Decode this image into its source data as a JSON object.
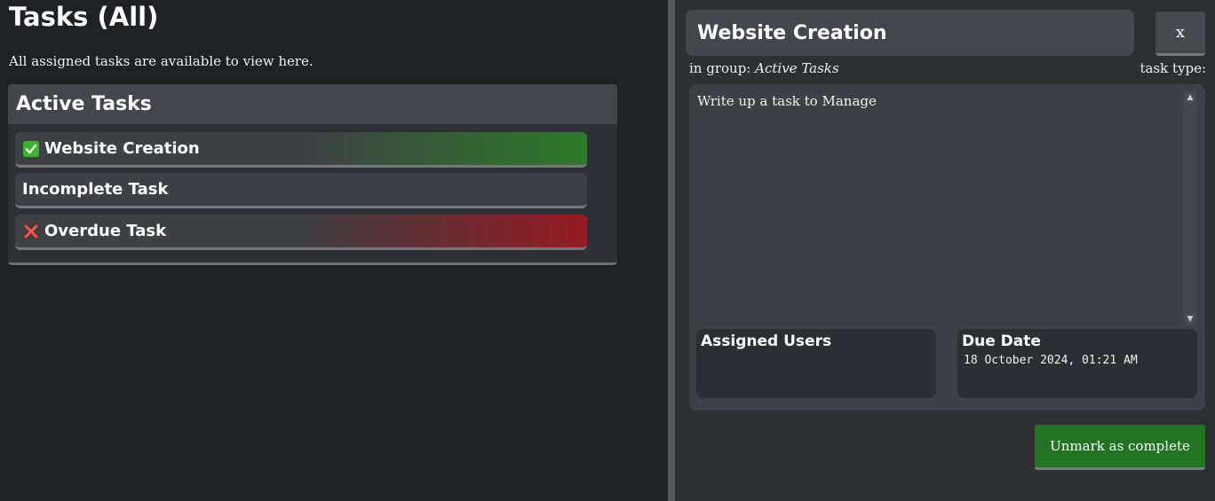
{
  "page": {
    "title": "Tasks (All)",
    "subtitle": "All assigned tasks are available to view here."
  },
  "group": {
    "title": "Active Tasks",
    "tasks": [
      {
        "label": "Website Creation",
        "status": "complete",
        "icon": "check-icon"
      },
      {
        "label": "Incomplete Task",
        "status": "incomplete",
        "icon": ""
      },
      {
        "label": "Overdue Task",
        "status": "overdue",
        "icon": "cross-icon"
      }
    ]
  },
  "detail": {
    "title": "Website Creation",
    "close_label": "x",
    "group_prefix": "in group:",
    "group_name": "Active Tasks",
    "task_type_label": "task type:",
    "description": "Write up a task to Manage",
    "assigned_users_label": "Assigned Users",
    "due_date_label": "Due Date",
    "due_date_value": "18 October 2024, 01:21 AM",
    "action_button": "Unmark as complete"
  },
  "colors": {
    "complete": "#2b7a28",
    "overdue": "#961b22",
    "button_green": "#237324",
    "background": "#202125"
  }
}
